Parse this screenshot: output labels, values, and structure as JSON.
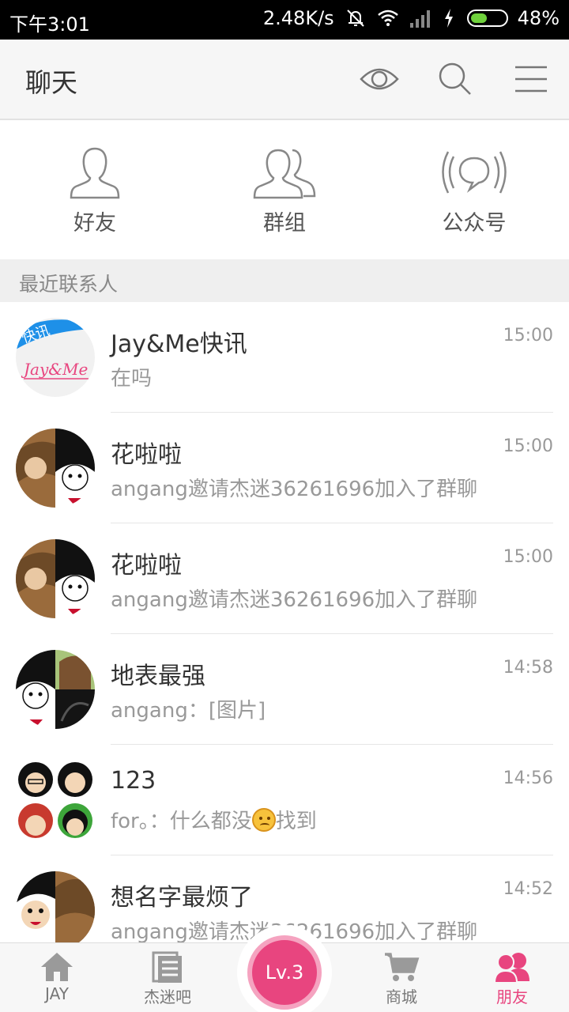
{
  "status_bar": {
    "time": "下午3:01",
    "speed": "2.48K/s",
    "battery": "48%",
    "battery_level": 0.48
  },
  "header": {
    "title": "聊天"
  },
  "quick_entries": [
    {
      "label": "好友",
      "icon": "person-icon"
    },
    {
      "label": "群组",
      "icon": "group-icon"
    },
    {
      "label": "公众号",
      "icon": "broadcast-icon"
    }
  ],
  "section": {
    "label": "最近联系人"
  },
  "chats": [
    {
      "name": "Jay&Me快讯",
      "message": "在吗",
      "time": "15:00",
      "avatar_logo_text": "快讯 Jay&Me"
    },
    {
      "name": "花啦啦",
      "message": "angang邀请杰迷36261696加入了群聊",
      "time": "15:00"
    },
    {
      "name": "花啦啦",
      "message": "angang邀请杰迷36261696加入了群聊",
      "time": "15:00"
    },
    {
      "name": "地表最强",
      "message": "angang：[图片]",
      "time": "14:58"
    },
    {
      "name": "123",
      "message_before": "for。：什么都没",
      "message_after": "找到",
      "time": "14:56"
    },
    {
      "name": "想名字最烦了",
      "message": "angang邀请杰迷36261696加入了群聊",
      "time": "14:52"
    }
  ],
  "bottom_nav": {
    "items": [
      {
        "label": "JAY",
        "icon": "home-icon"
      },
      {
        "label": "杰迷吧",
        "icon": "document-icon"
      },
      {
        "label": "商城",
        "icon": "cart-icon"
      },
      {
        "label": "朋友",
        "icon": "friends-icon"
      }
    ],
    "level_badge": "Lv.3",
    "active_color": "#e8457f"
  }
}
